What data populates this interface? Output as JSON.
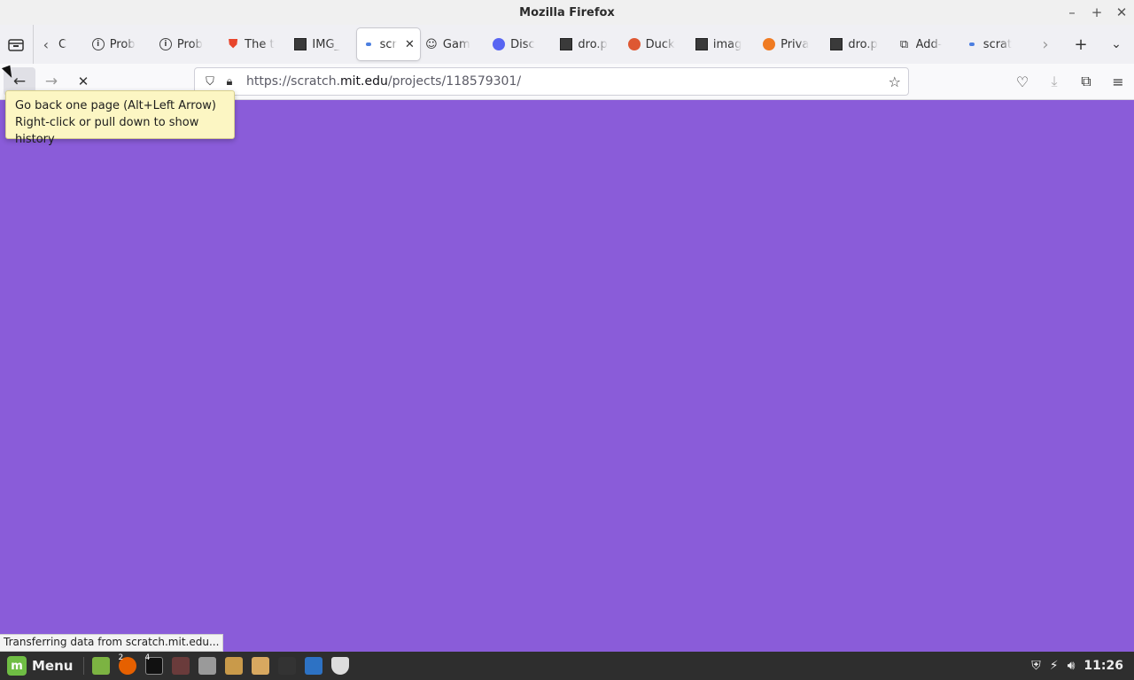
{
  "window": {
    "title": "Mozilla Firefox",
    "controls": [
      "–",
      "+",
      "✕"
    ]
  },
  "tabs": [
    {
      "label": "C",
      "favicon": "blank"
    },
    {
      "label": "Prob",
      "favicon": "info"
    },
    {
      "label": "Prob",
      "favicon": "info"
    },
    {
      "label": "The t",
      "favicon": "brave-shield"
    },
    {
      "label": "IMG_",
      "favicon": "image"
    },
    {
      "label": "scr",
      "favicon": "loading-dot",
      "active": true
    },
    {
      "label": "Gam",
      "favicon": "game"
    },
    {
      "label": "Disc",
      "favicon": "discord"
    },
    {
      "label": "dro.p",
      "favicon": "image"
    },
    {
      "label": "Duck",
      "favicon": "duckduckgo"
    },
    {
      "label": "imag",
      "favicon": "image"
    },
    {
      "label": "Priva",
      "favicon": "brave"
    },
    {
      "label": "dro.p",
      "favicon": "image"
    },
    {
      "label": "Add-",
      "favicon": "puzzle"
    },
    {
      "label": "scrat",
      "favicon": "loading-dot"
    }
  ],
  "navbar": {
    "url_prefix": "https://scratch.",
    "url_host": "mit.edu",
    "url_path": "/projects/118579301/"
  },
  "tooltip": {
    "line1": "Go back one page (Alt+Left Arrow)",
    "line2": "Right-click or pull down to show history"
  },
  "status_text": "Transferring data from scratch.mit.edu...",
  "content": {
    "background": "#8a5cd9"
  },
  "taskbar": {
    "menu_label": "Menu",
    "firefox_badge": "2",
    "terminal_badge": "4",
    "clock": "11:26"
  }
}
